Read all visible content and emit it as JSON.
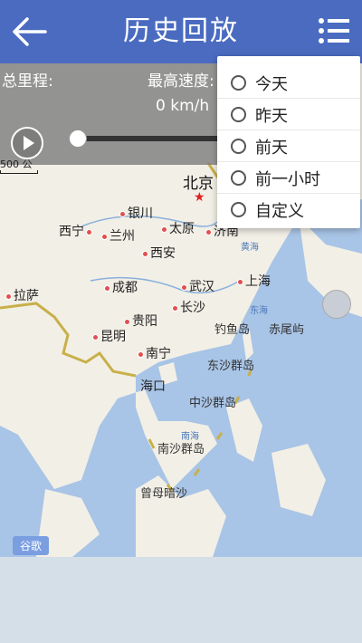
{
  "header": {
    "title": "历史回放",
    "back_icon": "arrow-left-icon",
    "menu_icon": "list-menu-icon"
  },
  "overlay": {
    "total_mileage_label": "总里程:",
    "max_speed_label": "最高速度:",
    "speed_value": "0 km/h"
  },
  "map": {
    "scale_label": "500 公",
    "cities": [
      "北京",
      "银川",
      "太原",
      "济南",
      "西宁",
      "兰州",
      "西安",
      "上海",
      "拉萨",
      "成都",
      "武汉",
      "长沙",
      "贵阳",
      "昆明",
      "南宁",
      "海口"
    ],
    "seas": [
      "黄海",
      "东海",
      "南海"
    ],
    "islands": [
      "钓鱼岛",
      "赤尾屿",
      "东沙群岛",
      "中沙群岛",
      "南沙群岛",
      "曾母暗沙"
    ],
    "attribution": "谷歌"
  },
  "dropdown": {
    "options": [
      {
        "label": "今天"
      },
      {
        "label": "昨天"
      },
      {
        "label": "前天"
      },
      {
        "label": "前一小时"
      },
      {
        "label": "自定义"
      }
    ]
  },
  "colors": {
    "header": "#4a6bc0",
    "water": "#a8c4e6",
    "land": "#f2efe6"
  }
}
